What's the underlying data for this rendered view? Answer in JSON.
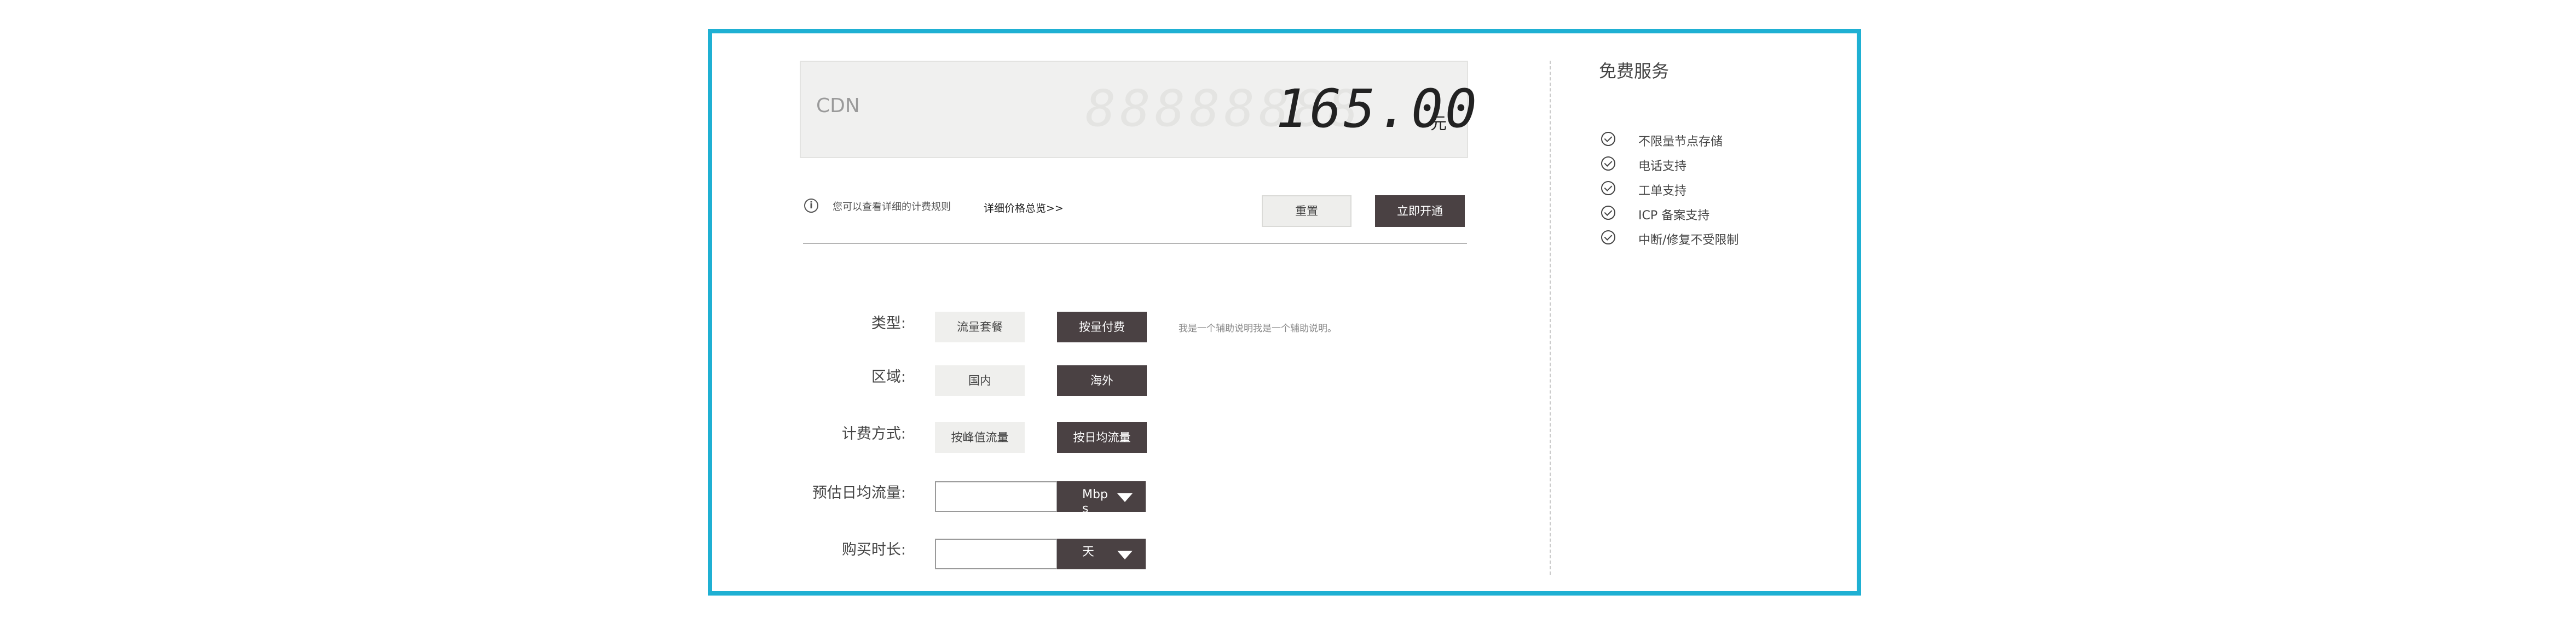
{
  "price": {
    "product_label": "CDN",
    "ghost_digits": "88888888",
    "amount": "165.00",
    "unit": "元"
  },
  "info": {
    "note": "您可以查看详细的计费规则",
    "link": "详细价格总览>>"
  },
  "actions": {
    "reset_label": "重置",
    "open_label": "立即开通"
  },
  "form": {
    "type": {
      "label": "类型:",
      "options": [
        "流量套餐",
        "按量付费"
      ],
      "selected": "按量付费",
      "helper": "我是一个辅助说明我是一个辅助说明。"
    },
    "region": {
      "label": "区域:",
      "options": [
        "国内",
        "海外"
      ],
      "selected": "海外"
    },
    "billing": {
      "label": "计费方式:",
      "options": [
        "按峰值流量",
        "按日均流量"
      ],
      "selected": "按日均流量"
    },
    "traffic": {
      "label": "预估日均流量:",
      "value": "",
      "unit": "Mbps"
    },
    "duration": {
      "label": "购买时长:",
      "value": "",
      "unit": "天"
    }
  },
  "free_service": {
    "title": "免费服务",
    "items": [
      "不限量节点存储",
      "电话支持",
      "工单支持",
      "ICP 备案支持",
      "中断/修复不受限制"
    ]
  },
  "colors": {
    "frame": "#1fb0d3",
    "selected_bg": "#4a4143",
    "unselected_bg": "#efefed"
  }
}
